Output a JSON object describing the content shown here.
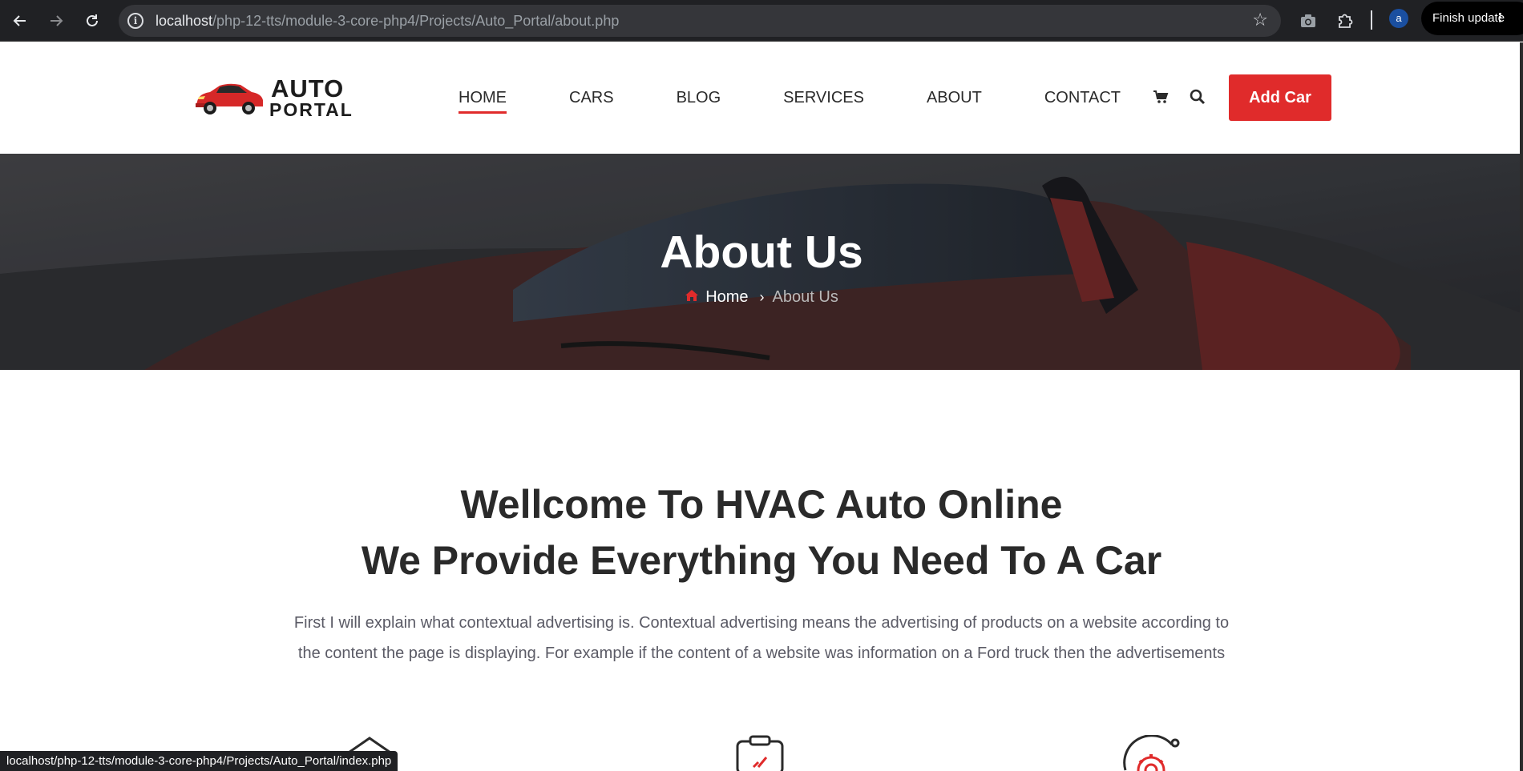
{
  "browser": {
    "url_host": "localhost",
    "url_path": "/php-12-tts/module-3-core-php4/Projects/Auto_Portal/about.php",
    "profile_initial": "a",
    "finish_update_label": "Finish update",
    "status_url": "localhost/php-12-tts/module-3-core-php4/Projects/Auto_Portal/index.php"
  },
  "logo": {
    "line1": "AUTO",
    "line2": "PORTAL"
  },
  "nav": {
    "items": [
      {
        "label": "HOME",
        "active": true
      },
      {
        "label": "CARS"
      },
      {
        "label": "BLOG"
      },
      {
        "label": "SERVICES"
      },
      {
        "label": "ABOUT"
      },
      {
        "label": "CONTACT"
      }
    ],
    "cta_label": "Add Car"
  },
  "hero": {
    "title": "About Us",
    "breadcrumb": {
      "home": "Home",
      "current": "About Us"
    }
  },
  "welcome": {
    "title_line1": "Wellcome To HVAC Auto Online",
    "title_line2": "We Provide Everything You Need To A Car",
    "paragraph_line1": "First I will explain what contextual advertising is. Contextual advertising means the advertising of products on a website according to",
    "paragraph_line2": "the content the page is displaying. For example if the content of a website was information on a Ford truck then the advertisements"
  },
  "colors": {
    "accent": "#e02b2b",
    "heading": "#2a2a2a",
    "body_text": "#5b5b66"
  },
  "icons": [
    "back-icon",
    "forward-icon",
    "reload-icon",
    "site-info-icon",
    "bookmark-star-icon",
    "camera-icon",
    "extensions-icon",
    "cart-icon",
    "search-icon",
    "home-icon",
    "chevron-right-icon",
    "house-icon",
    "clipboard-check-icon",
    "gear-icon"
  ]
}
